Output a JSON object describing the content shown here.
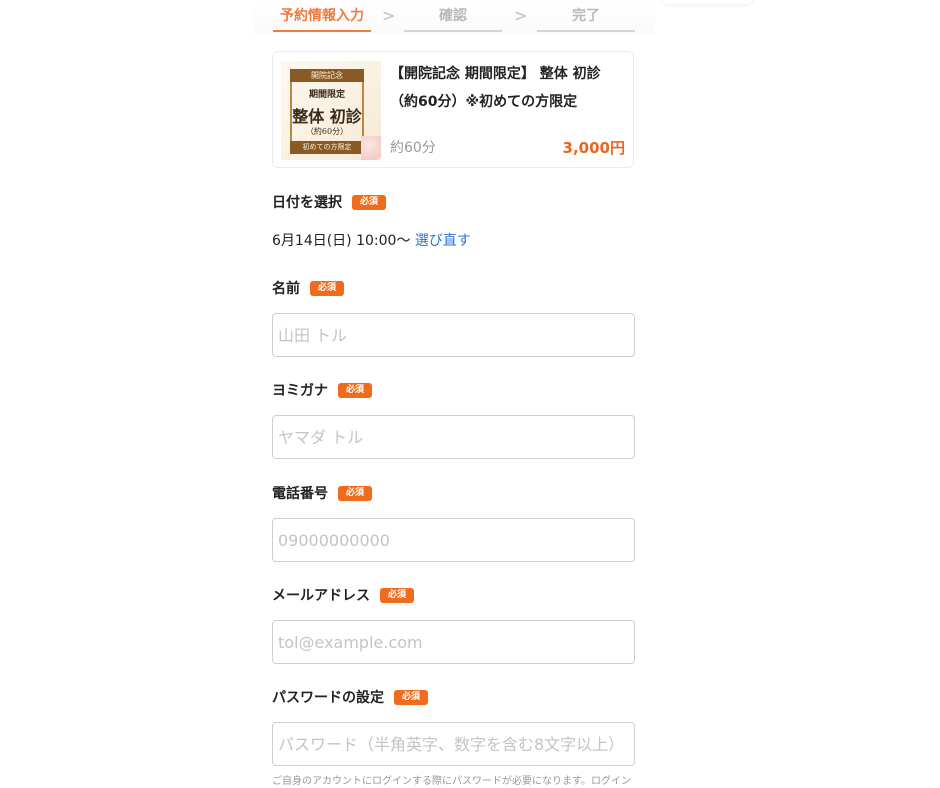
{
  "steps": [
    {
      "label": "予約情報入力",
      "active": true
    },
    {
      "label": "確認",
      "active": false
    },
    {
      "label": "完了",
      "active": false
    }
  ],
  "step_separator": ">",
  "plan": {
    "thumbnail": {
      "line1": "開院記念",
      "line2": "期間限定",
      "line3": "整体 初診",
      "line4": "（約60分）",
      "line5": "初めての方限定"
    },
    "title": "【開院記念 期間限定】 整体 初診（約60分）※初めての方限定",
    "duration": "約60分",
    "price": "3,000円"
  },
  "required_badge": "必須",
  "date_section": {
    "label": "日付を選択",
    "selected": "6月14日(日) 10:00〜",
    "reselect_link": "選び直す"
  },
  "fields": {
    "name": {
      "label": "名前",
      "placeholder": "山田 トル",
      "value": ""
    },
    "kana": {
      "label": "ヨミガナ",
      "placeholder": "ヤマダ トル",
      "value": ""
    },
    "phone": {
      "label": "電話番号",
      "placeholder": "09000000000",
      "value": ""
    },
    "email": {
      "label": "メールアドレス",
      "placeholder": "tol@example.com",
      "value": ""
    },
    "password": {
      "label": "パスワードの設定",
      "placeholder": "パスワード（半角英字、数字を含む8文字以上）",
      "value": ""
    }
  },
  "password_note": "ご自身のアカウントにログインする際にパスワードが必要になります。ログイン"
}
